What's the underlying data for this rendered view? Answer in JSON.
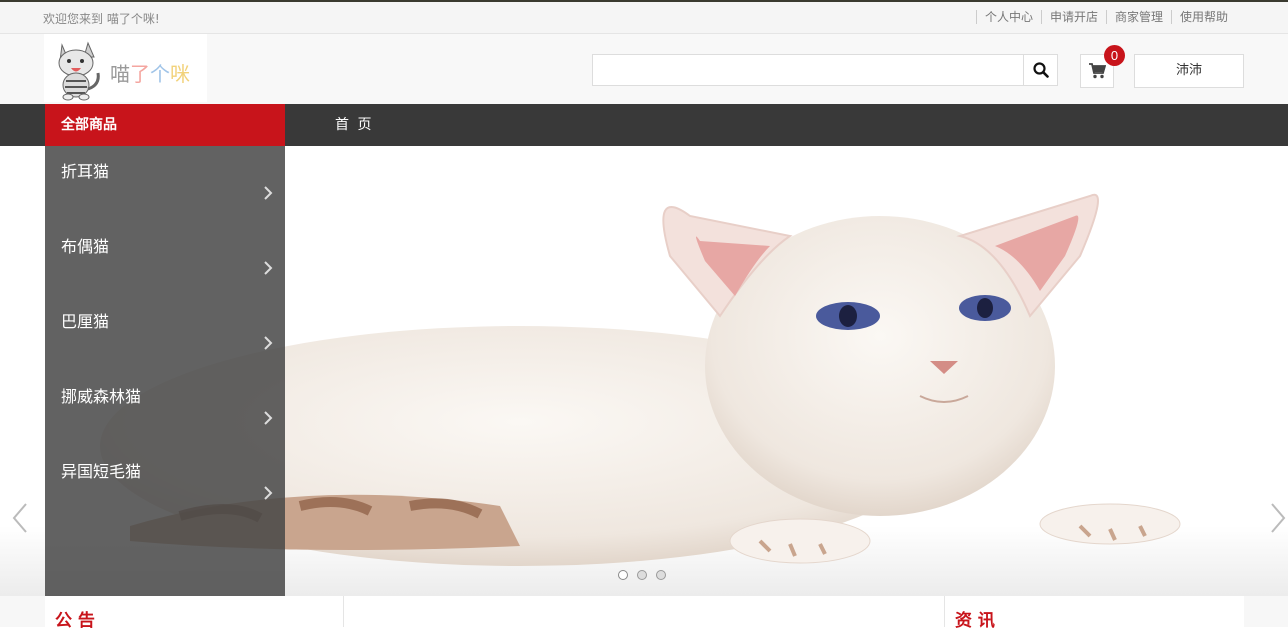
{
  "topbar": {
    "welcome": "欢迎您来到 喵了个咪!",
    "links": [
      "个人中心",
      "申请开店",
      "商家管理",
      "使用帮助"
    ]
  },
  "logo": {
    "c1": "喵",
    "c2": "了",
    "c3": "个",
    "c4": "咪"
  },
  "search": {
    "placeholder": "",
    "value": ""
  },
  "cart": {
    "count": "0"
  },
  "user": {
    "name": "沛沛"
  },
  "nav": {
    "all_goods": "全部商品",
    "home": "首 页"
  },
  "categories": [
    "折耳猫",
    "布偶猫",
    "巴厘猫",
    "挪威森林猫",
    "异国短毛猫"
  ],
  "banner": {
    "slide_count": 3,
    "active_slide": 0
  },
  "bottom": {
    "notice_title": "公 告",
    "news_title": "资 讯"
  },
  "colors": {
    "accent": "#c8141b",
    "nav_bg": "#393939",
    "menu_bg": "#5a5a5a"
  }
}
